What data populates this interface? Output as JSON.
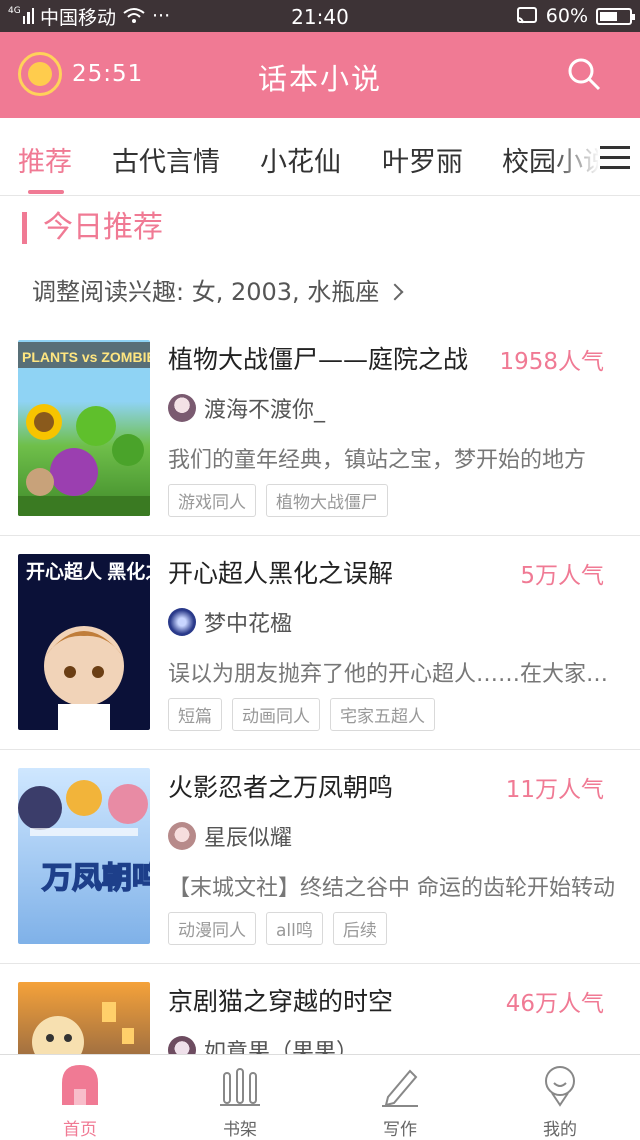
{
  "status_bar": {
    "carrier": "中国移动",
    "dots": "···",
    "time": "21:40",
    "battery": "60%",
    "battery_level": 0.6,
    "net_label": "4G"
  },
  "header": {
    "timer": "25:51",
    "title": "话本小说"
  },
  "tabs": [
    {
      "label": "推荐"
    },
    {
      "label": "古代言情"
    },
    {
      "label": "小花仙"
    },
    {
      "label": "叶罗丽"
    },
    {
      "label": "校园小说"
    }
  ],
  "section": {
    "title": "今日推荐",
    "preference": "调整阅读兴趣: 女, 2003, 水瓶座"
  },
  "books": [
    {
      "title": "植物大战僵尸——庭院之战",
      "popularity": "1958人气",
      "author": "渡海不渡你_",
      "desc": "我们的童年经典，镇站之宝，梦开始的地方",
      "tags": [
        "游戏同人",
        "植物大战僵尸"
      ],
      "cover_text": "PLANTS vs ZOMBIES"
    },
    {
      "title": "开心超人黑化之误解",
      "popularity": "5万人气",
      "author": "梦中花楹",
      "desc": "误以为朋友抛弃了他的开心超人……在大家的心中",
      "tags": [
        "短篇",
        "动画同人",
        "宅家五超人"
      ],
      "cover_text": "开心超人 黑化之误解"
    },
    {
      "title": "火影忍者之万凤朝鸣",
      "popularity": "11万人气",
      "author": "星辰似耀",
      "desc": "【末城文社】终结之谷中 命运的齿轮开始转动",
      "tags": [
        "动漫同人",
        "all鸣",
        "后续"
      ],
      "cover_text": "万凤朝鸣"
    },
    {
      "title": "京剧猫之穿越的时空",
      "popularity": "46万人气",
      "author": "如意果（果果）",
      "desc": "",
      "tags": [],
      "cover_text": ""
    }
  ],
  "bottom_nav": [
    {
      "label": "首页"
    },
    {
      "label": "书架"
    },
    {
      "label": "写作"
    },
    {
      "label": "我的"
    }
  ],
  "colors": {
    "accent": "#f07a94",
    "status_bar": "#3d3336"
  }
}
